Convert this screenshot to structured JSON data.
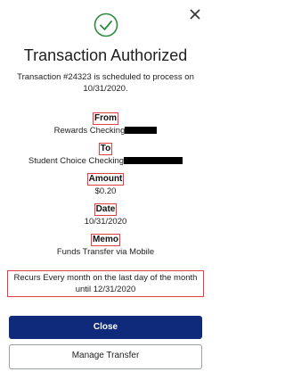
{
  "colors": {
    "success_green": "#2e8b3e",
    "highlight_red": "#e04040",
    "primary_button": "#0f2a7a"
  },
  "header": {
    "status_icon": "check-circle-icon",
    "close_icon": "close-icon",
    "title": "Transaction Authorized",
    "subtitle": "Transaction #24323 is scheduled to process on 10/31/2020."
  },
  "details": {
    "from_label": "From",
    "from_value": "Rewards Checking",
    "to_label": "To",
    "to_value": "Student Choice Checking",
    "amount_label": "Amount",
    "amount_value": "$0.20",
    "date_label": "Date",
    "date_value": "10/31/2020",
    "memo_label": "Memo",
    "memo_value": "Funds Transfer via Mobile"
  },
  "recurrence": "Recurs Every month on the last day of the month until 12/31/2020",
  "buttons": {
    "close": "Close",
    "manage_transfer": "Manage Transfer"
  }
}
